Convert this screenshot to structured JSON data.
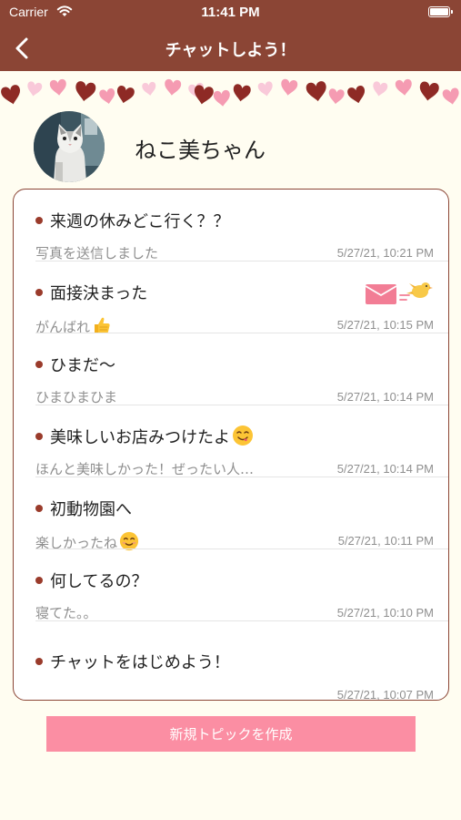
{
  "status_bar": {
    "carrier": "Carrier",
    "time": "11:41 PM"
  },
  "nav": {
    "title": "チャットしよう！"
  },
  "profile": {
    "name": "ねこ美ちゃん"
  },
  "topics": [
    {
      "title": "来週の休みどこ行く？？",
      "preview": "写真を送信しました",
      "time": "5/27/21, 10:21 PM"
    },
    {
      "title": "面接決まった",
      "preview": "がんばれ",
      "time": "5/27/21, 10:15 PM",
      "preview_emoji": "thumbs-up"
    },
    {
      "title": "ひまだ〜",
      "preview": "ひまひまひま",
      "time": "5/27/21, 10:14 PM"
    },
    {
      "title": "美味しいお店みつけたよ",
      "preview": "ほんと美味しかった！ぜったい人…",
      "time": "5/27/21, 10:14 PM",
      "title_emoji": "yum-face"
    },
    {
      "title": "初動物園へ",
      "preview": "楽しかったね",
      "time": "5/27/21, 10:11 PM",
      "preview_emoji": "smile-face"
    },
    {
      "title": "何してるの？",
      "preview": "寝てた。。",
      "time": "5/27/21, 10:10 PM"
    },
    {
      "title": "チャットをはじめよう！",
      "preview": "",
      "time": "5/27/21, 10:07 PM"
    }
  ],
  "new_topic_button": {
    "label": "新規トピックを作成"
  },
  "colors": {
    "brand": "#8b4535",
    "background": "#fffdf1",
    "button": "#fb8ea3",
    "bullet": "#9a3b2b",
    "heart_dark": "#8e2a25",
    "heart_pink": "#f59bb2",
    "heart_light": "#f9c9d9"
  },
  "icons": {
    "back": "chevron-left-icon",
    "wifi": "wifi-icon",
    "battery": "battery-icon",
    "envelope": "envelope-icon",
    "bird": "bird-icon"
  }
}
